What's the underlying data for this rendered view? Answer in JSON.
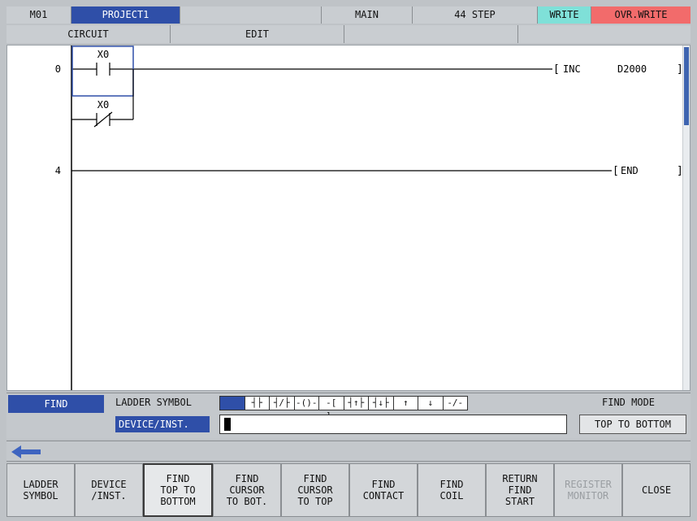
{
  "status_bar": {
    "station": "M01",
    "project": "PROJECT1",
    "program": "MAIN",
    "steps": "44 STEP",
    "write_mode": "WRITE",
    "overwrite_mode": "OVR.WRITE"
  },
  "colors": {
    "project_bg": "#2f4fa8",
    "write_bg": "#7fe0d8",
    "overwrite_bg": "#f26b6b",
    "selection": "#2f4fa8"
  },
  "menu_bar": {
    "circuit": "CIRCUIT",
    "edit": "EDIT"
  },
  "ladder": {
    "rungs": [
      {
        "step": "0",
        "contacts": [
          "X0",
          "X0"
        ],
        "instruction": "INC",
        "operand": "D2000"
      },
      {
        "step": "4",
        "instruction": "END"
      }
    ]
  },
  "find_panel": {
    "label": "FIND",
    "ladder_symbol_label": "LADDER SYMBOL",
    "device_label": "DEVICE/INST.",
    "device_value": "",
    "symbols": [
      "",
      "┤├",
      "┤/├",
      "-()-",
      "-[ ]-",
      "┤↑├",
      "┤↓├",
      "↑",
      "↓",
      "-/-"
    ],
    "find_mode_label": "FIND MODE",
    "find_mode_value": "TOP TO BOTTOM"
  },
  "function_keys": [
    {
      "label": "LADDER\nSYMBOL",
      "state": "normal"
    },
    {
      "label": "DEVICE\n/INST.",
      "state": "normal"
    },
    {
      "label": "FIND\nTOP TO\nBOTTOM",
      "state": "active"
    },
    {
      "label": "FIND\nCURSOR\nTO BOT.",
      "state": "normal"
    },
    {
      "label": "FIND\nCURSOR\nTO TOP",
      "state": "normal"
    },
    {
      "label": "FIND\nCONTACT",
      "state": "normal"
    },
    {
      "label": "FIND\nCOIL",
      "state": "normal"
    },
    {
      "label": "RETURN\nFIND\nSTART",
      "state": "normal"
    },
    {
      "label": "REGISTER\nMONITOR",
      "state": "disabled"
    },
    {
      "label": "CLOSE",
      "state": "normal"
    }
  ],
  "nav": {
    "back_icon": "left-arrow-icon"
  }
}
